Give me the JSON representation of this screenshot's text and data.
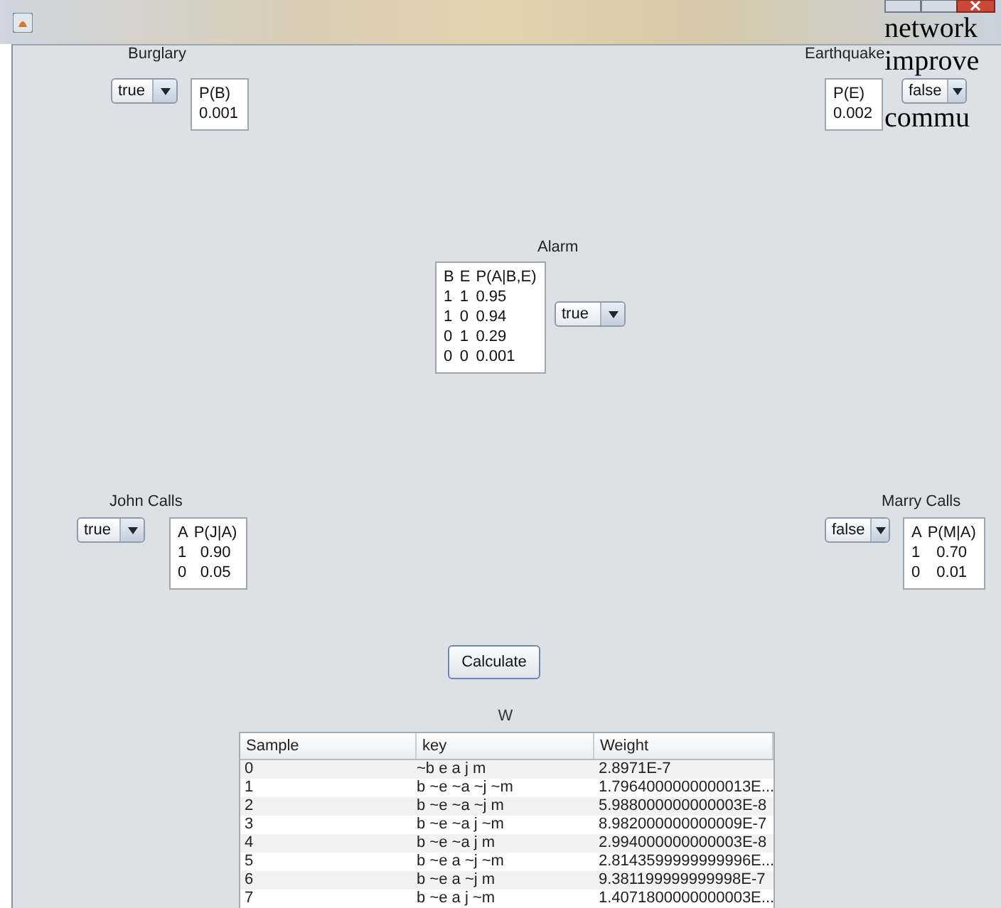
{
  "nodes": [
    {
      "name": "Burglary",
      "value": "true",
      "cpt": {
        "header": [
          "P(B)"
        ],
        "rows": [
          [
            "0.001"
          ]
        ]
      }
    },
    {
      "name": "Earthquake",
      "value": "false",
      "cpt": {
        "header": [
          "P(E)"
        ],
        "rows": [
          [
            "0.002"
          ]
        ]
      }
    },
    {
      "name": "Alarm",
      "value": "true",
      "cpt": {
        "header": [
          "B",
          "E",
          "P(A|B,E)"
        ],
        "rows": [
          [
            "1",
            "1",
            "0.95"
          ],
          [
            "1",
            "0",
            "0.94"
          ],
          [
            "0",
            "1",
            "0.29"
          ],
          [
            "0",
            "0",
            "0.001"
          ]
        ]
      }
    },
    {
      "name": "John Calls",
      "value": "true",
      "cpt": {
        "header": [
          "A",
          "P(J|A)"
        ],
        "rows": [
          [
            "1",
            "0.90"
          ],
          [
            "0",
            "0.05"
          ]
        ]
      }
    },
    {
      "name": "Marry Calls",
      "value": "false",
      "cpt": {
        "header": [
          "A",
          "P(M|A)"
        ],
        "rows": [
          [
            "1",
            "0.70"
          ],
          [
            "0",
            "0.01"
          ]
        ]
      }
    }
  ],
  "calculate_button": "Calculate",
  "table": {
    "title": "W",
    "columns": [
      "Sample",
      "key",
      "Weight"
    ],
    "rows": [
      [
        "0",
        "~b e a j m",
        "2.8971E-7"
      ],
      [
        "1",
        "b ~e ~a ~j ~m",
        "1.7964000000000013E..."
      ],
      [
        "2",
        "b ~e ~a ~j m",
        "5.988000000000003E-8"
      ],
      [
        "3",
        "b ~e ~a j ~m",
        "8.982000000000009E-7"
      ],
      [
        "4",
        "b ~e ~a j m",
        "2.994000000000003E-8"
      ],
      [
        "5",
        "b ~e a ~j ~m",
        "2.8143599999999996E..."
      ],
      [
        "6",
        "b ~e a ~j m",
        "9.381199999999998E-7"
      ],
      [
        "7",
        "b ~e a j ~m",
        "1.4071800000000003E..."
      ]
    ]
  },
  "overlay_text": [
    "network",
    "improve",
    "commu"
  ]
}
